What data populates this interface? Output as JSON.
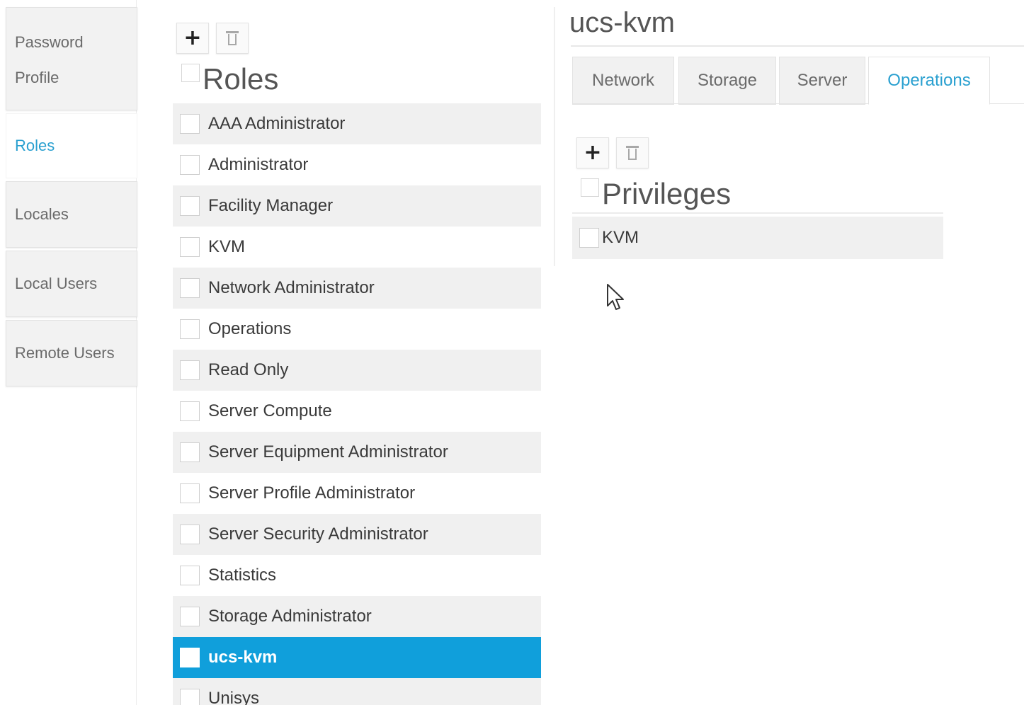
{
  "sidebar": {
    "items": [
      {
        "label_line1": "Password",
        "label_line2": "Profile",
        "active": false
      },
      {
        "label": "Roles",
        "active": true
      },
      {
        "label": "Locales",
        "active": false
      },
      {
        "label": "Local Users",
        "active": false
      },
      {
        "label": "Remote Users",
        "active": false
      }
    ]
  },
  "roles": {
    "heading": "Roles",
    "add_icon": "plus-icon",
    "delete_icon": "trash-icon",
    "items": [
      "AAA Administrator",
      "Administrator",
      "Facility Manager",
      "KVM",
      "Network Administrator",
      "Operations",
      "Read Only",
      "Server Compute",
      "Server Equipment Administrator",
      "Server Profile Administrator",
      "Server Security Administrator",
      "Statistics",
      "Storage Administrator",
      "ucs-kvm",
      "Unisys"
    ],
    "selected": "ucs-kvm"
  },
  "detail": {
    "title": "ucs-kvm",
    "tabs": [
      "Network",
      "Storage",
      "Server",
      "Operations"
    ],
    "active_tab": "Operations",
    "privileges_heading": "Privileges",
    "privileges": [
      "KVM"
    ]
  },
  "colors": {
    "accent": "#2aa0d0",
    "selected_row": "#109fdb",
    "row_stripe": "#f0f0f0"
  }
}
